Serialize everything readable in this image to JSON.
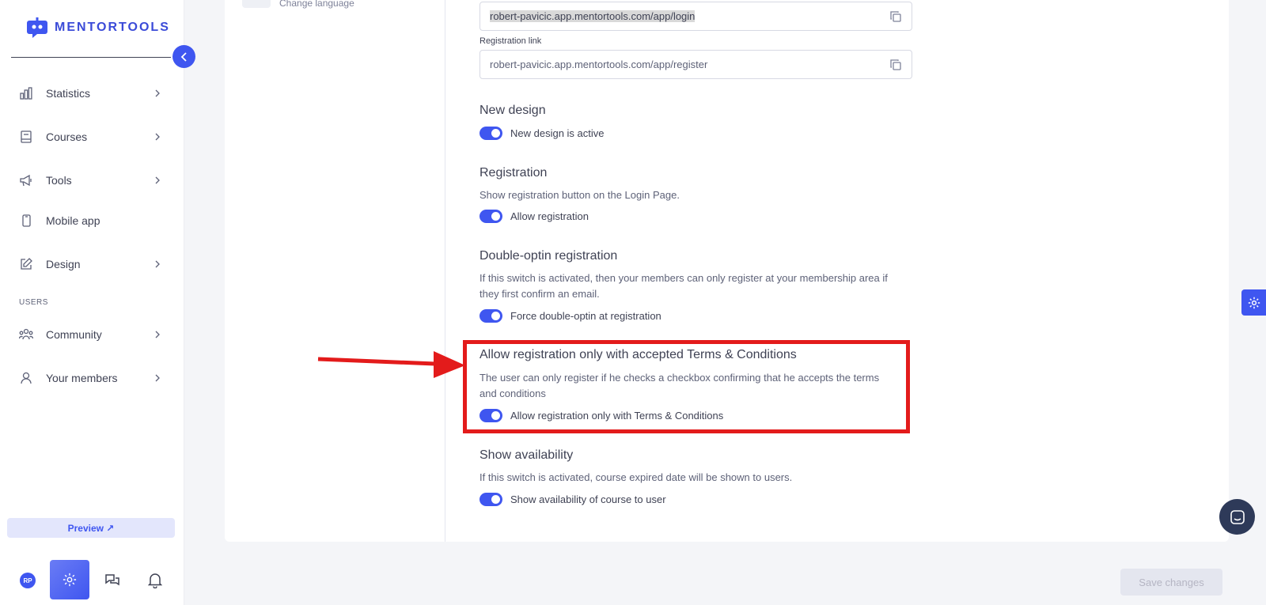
{
  "brand": {
    "name": "MENTORTOOLS",
    "accent": "#3f56f0"
  },
  "sidebar": {
    "items": [
      {
        "label": "Statistics",
        "icon": "bar-chart-icon",
        "has_children": true
      },
      {
        "label": "Courses",
        "icon": "book-icon",
        "has_children": true
      },
      {
        "label": "Tools",
        "icon": "megaphone-icon",
        "has_children": true
      },
      {
        "label": "Mobile app",
        "icon": "mobile-icon",
        "has_children": false
      },
      {
        "label": "Design",
        "icon": "pencil-icon",
        "has_children": true
      }
    ],
    "users_section_label": "USERS",
    "user_items": [
      {
        "label": "Community",
        "icon": "community-icon",
        "has_children": true
      },
      {
        "label": "Your members",
        "icon": "user-icon",
        "has_children": true
      }
    ],
    "preview_label": "Preview ↗",
    "avatar_initials": "RP"
  },
  "settings": {
    "change_language_label": "Change language",
    "login_link_value": "robert-pavicic.app.mentortools.com/app/login",
    "registration_link_label": "Registration link",
    "registration_link_value": "robert-pavicic.app.mentortools.com/app/register",
    "new_design": {
      "title": "New design",
      "toggle_label": "New design is active",
      "enabled": true
    },
    "registration": {
      "title": "Registration",
      "description": "Show registration button on the Login Page.",
      "toggle_label": "Allow registration",
      "enabled": true
    },
    "double_optin": {
      "title": "Double-optin registration",
      "description": "If this switch is activated, then your members can only register at your membership area if they first confirm an email.",
      "toggle_label": "Force double-optin at registration",
      "enabled": true
    },
    "terms": {
      "title": "Allow registration only with accepted Terms & Conditions",
      "description": "The user can only register if he checks a checkbox confirming that he accepts the terms and conditions",
      "toggle_label": "Allow registration only with Terms & Conditions",
      "enabled": true
    },
    "availability": {
      "title": "Show availability",
      "description": "If this switch is activated, course expired date will be shown to users.",
      "toggle_label": "Show availability of course to user",
      "enabled": true
    }
  },
  "footer": {
    "save_label": "Save changes"
  },
  "annotation": {
    "color": "#e31b1b"
  }
}
